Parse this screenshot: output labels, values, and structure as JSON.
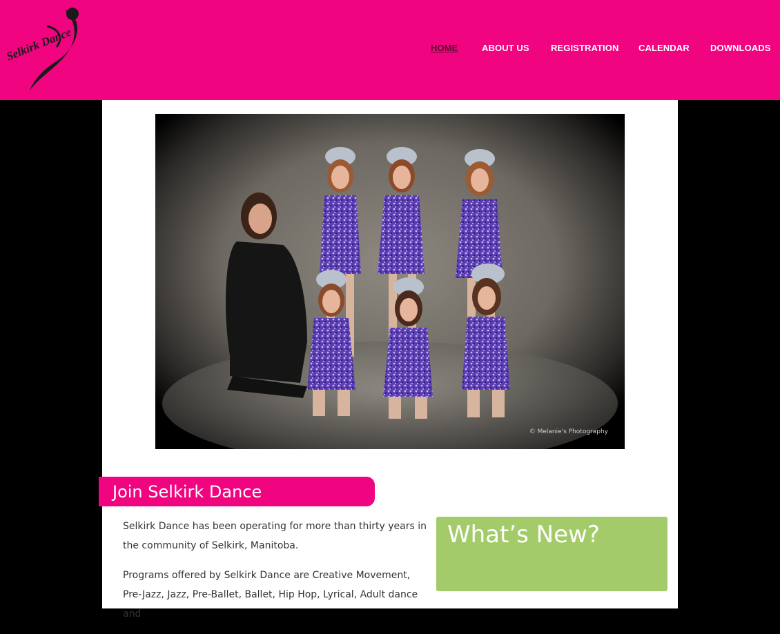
{
  "header": {
    "logo_text": "Selkirk Dance",
    "nav": [
      {
        "label": "HOME",
        "active": true
      },
      {
        "label": "ABOUT US",
        "active": false
      },
      {
        "label": "REGISTRATION",
        "active": false
      },
      {
        "label": "CALENDAR",
        "active": false
      },
      {
        "label": "DOWNLOADS",
        "active": false
      }
    ]
  },
  "hero": {
    "credit": "© Melanie's Photography"
  },
  "main": {
    "heading": "Join Selkirk Dance",
    "paragraphs": [
      "Selkirk Dance has been operating for more than thirty years in the community of Selkirk, Manitoba.",
      "Programs offered by Selkirk Dance are Creative Movement, Pre-Jazz, Jazz, Pre-Ballet, Ballet, Hip Hop, Lyrical, Adult dance and"
    ]
  },
  "sidebar": {
    "whats_new_title": "What’s New?"
  },
  "colors": {
    "brand_pink": "#f0047f",
    "accent_green": "#a4cb6a",
    "background": "#000000"
  }
}
